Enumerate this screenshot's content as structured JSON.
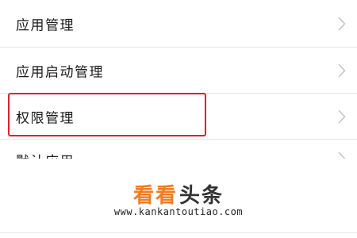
{
  "settings_list": {
    "items": [
      {
        "label": "应用管理",
        "chevron_icon": "chevron-right-icon"
      },
      {
        "label": "应用启动管理",
        "chevron_icon": "chevron-right-icon"
      },
      {
        "label": "权限管理",
        "chevron_icon": "chevron-right-icon",
        "highlighted": true
      },
      {
        "label": "默认应用",
        "chevron_icon": "chevron-right-icon",
        "partially_visible": true
      }
    ]
  },
  "watermark": {
    "brand_part1": "看看",
    "brand_part2": "头条",
    "url": "www.kankantoutiao.com"
  },
  "colors": {
    "background": "#ffffff",
    "highlight_border": "#e0202b",
    "divider": "#e6e6e6",
    "chevron": "#c4c4c4",
    "watermark_orange": "#f47b20"
  }
}
